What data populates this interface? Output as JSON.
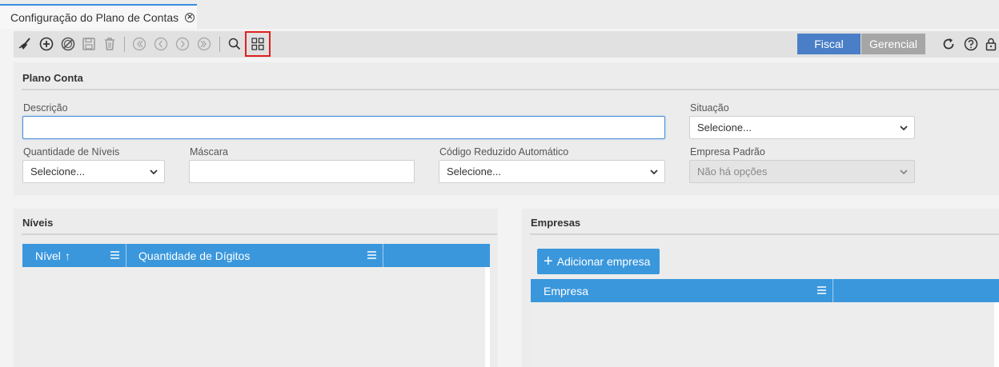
{
  "tab": {
    "title": "Configuração do Plano de Contas"
  },
  "toolbar": {
    "icons": [
      "broom-icon",
      "add-icon",
      "cancel-icon",
      "save-icon",
      "delete-icon",
      "first-icon",
      "previous-icon",
      "next-icon",
      "last-icon",
      "search-icon",
      "grid-view-icon"
    ],
    "fiscal_label": "Fiscal",
    "gerencial_label": "Gerencial"
  },
  "plano_conta": {
    "title": "Plano Conta",
    "descricao_label": "Descrição",
    "descricao_value": "",
    "situacao_label": "Situação",
    "situacao_value": "Selecione...",
    "qtd_niveis_label": "Quantidade de Níveis",
    "qtd_niveis_value": "Selecione...",
    "mascara_label": "Máscara",
    "mascara_value": "",
    "codigo_reduzido_label": "Código Reduzido Automático",
    "codigo_reduzido_value": "Selecione...",
    "empresa_padrao_label": "Empresa Padrão",
    "empresa_padrao_value": "Não há opções"
  },
  "niveis": {
    "title": "Níveis",
    "columns": [
      "Nível",
      "Quantidade de Dígitos"
    ]
  },
  "empresas": {
    "title": "Empresas",
    "add_label": "Adicionar empresa",
    "columns": [
      "Empresa"
    ]
  },
  "colors": {
    "accent": "#3a97dc",
    "fiscal": "#4a7ec7",
    "highlight": "#e0201c"
  }
}
